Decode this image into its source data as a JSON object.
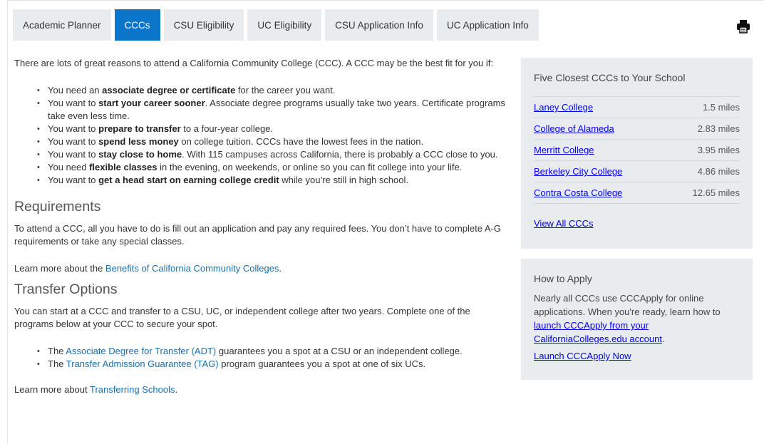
{
  "tabs": [
    {
      "label": "Academic Planner"
    },
    {
      "label": "CCCs"
    },
    {
      "label": "CSU Eligibility"
    },
    {
      "label": "UC Eligibility"
    },
    {
      "label": "CSU Application Info"
    },
    {
      "label": "UC Application Info"
    }
  ],
  "active_tab": "CCCs",
  "intro": "There are lots of great reasons to attend a California Community College (CCC).  A CCC may be the best fit for you if:",
  "reasons": [
    {
      "pre": "You need an ",
      "bold": "associate degree or certificate",
      "post": " for the career you want."
    },
    {
      "pre": "You want to ",
      "bold": "start your career sooner",
      "post": ".  Associate degree programs usually take two years.  Certificate programs take even less time."
    },
    {
      "pre": "You want to ",
      "bold": "prepare to transfer",
      "post": " to a four-year college."
    },
    {
      "pre": "You want to ",
      "bold": "spend less money",
      "post": " on college tuition. CCCs have the lowest fees in the nation."
    },
    {
      "pre": "You want to ",
      "bold": "stay close to home",
      "post": ". With 115 campuses across California, there is probably a CCC close to you."
    },
    {
      "pre": "You need ",
      "bold": "flexible classes",
      "post": " in the evening, on weekends, or online so you can fit college into your life."
    },
    {
      "pre": "You want to ",
      "bold": "get a head start on earning college credit",
      "post": " while you’re still in high school."
    }
  ],
  "requirements": {
    "heading": "Requirements",
    "text": "To attend a CCC, all you have to do is fill out an application and pay any required fees. You don’t have to complete A-G requirements or take any special classes.",
    "learn_pre": "Learn more about the ",
    "learn_link": "Benefits of California Community Colleges",
    "learn_post": "."
  },
  "transfer": {
    "heading": "Transfer Options",
    "text": "You can start at a CCC and transfer to a CSU, UC, or independent college after two years. Complete one of the programs below at your CCC to secure your spot.",
    "items": [
      {
        "pre": "The ",
        "link": "Associate Degree for Transfer (ADT)",
        "post": " guarantees you a spot at a CSU or an independent college."
      },
      {
        "pre": "The ",
        "link": "Transfer Admission Guarantee (TAG)",
        "post": " program guarantees you a spot at one of six UCs."
      }
    ],
    "learn_pre": "Learn more about ",
    "learn_link": "Transferring Schools",
    "learn_post": "."
  },
  "closest": {
    "title": "Five Closest CCCs to Your School",
    "colleges": [
      {
        "name": "Laney College",
        "distance": "1.5 miles"
      },
      {
        "name": "College of Alameda",
        "distance": "2.83 miles"
      },
      {
        "name": "Merritt College",
        "distance": "3.95 miles"
      },
      {
        "name": "Berkeley City College",
        "distance": "4.86 miles"
      },
      {
        "name": "Contra Costa College",
        "distance": "12.65 miles"
      }
    ],
    "view_all": "View All CCCs"
  },
  "how_to_apply": {
    "title": "How to Apply",
    "text": "Nearly all CCCs use CCCApply for online applications. When you're ready, learn how to ",
    "link": "launch CCCApply from your CaliforniaColleges.edu account",
    "post": ".",
    "launch": "Launch CCCApply Now"
  },
  "icons": {
    "print": "print-icon"
  },
  "colors": {
    "accent": "#0b75c9",
    "link": "#1a6fae",
    "panel": "#e9ecef"
  }
}
